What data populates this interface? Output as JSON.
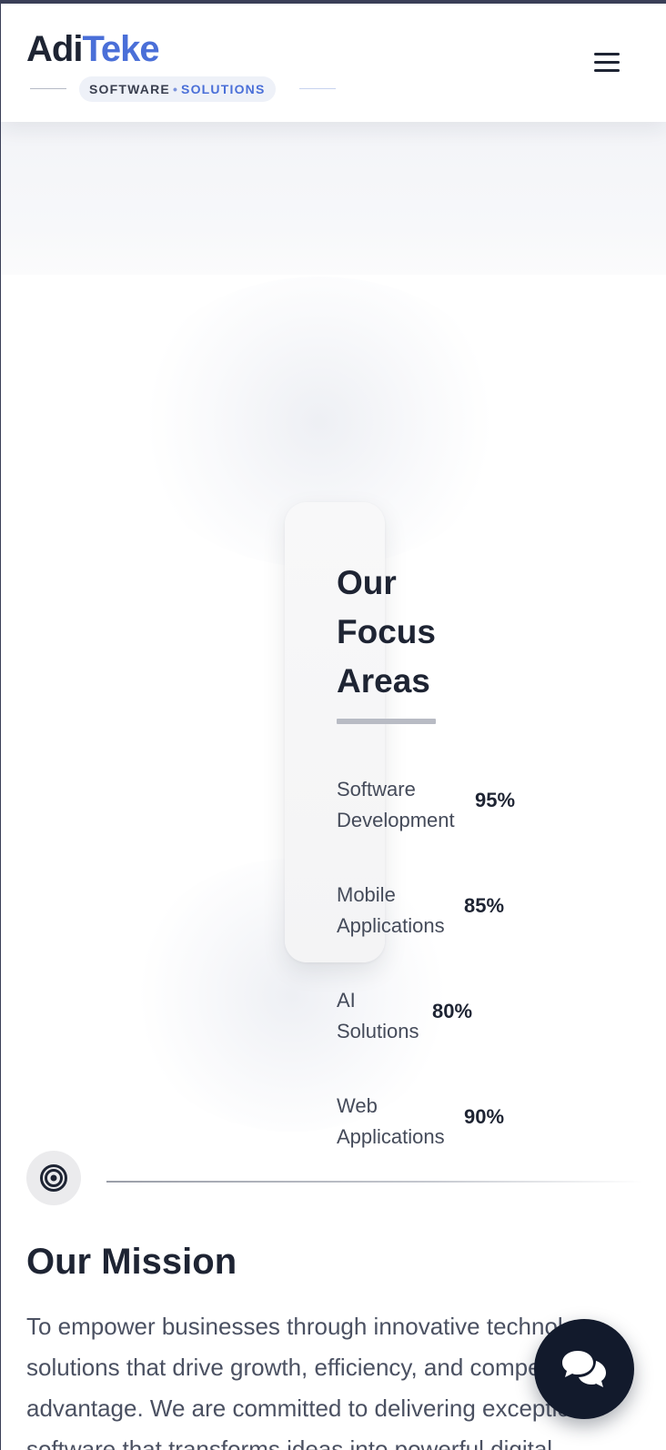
{
  "header": {
    "logo_part1": "Adi",
    "logo_part2": "Teke",
    "tagline_part1": "SOFTWARE",
    "tagline_separator": "•",
    "tagline_part2": "SOLUTIONS",
    "menu_icon": "hamburger-menu-icon"
  },
  "focus": {
    "title": "Our Focus Areas",
    "items": [
      {
        "label_line1": "Software",
        "label_line2": "Development",
        "percent": "95%"
      },
      {
        "label_line1": "Mobile",
        "label_line2": "Applications",
        "percent": "85%"
      },
      {
        "label_line1": "AI",
        "label_line2": "Solutions",
        "percent": "80%"
      },
      {
        "label_line1": "Web",
        "label_line2": "Applications",
        "percent": "90%"
      }
    ]
  },
  "mission": {
    "icon": "target-icon",
    "title": "Our Mission",
    "text": "To empower businesses through innovative technology solutions that drive growth, efficiency, and competitive advantage. We are committed to delivering exceptional software that transforms ideas into powerful digital"
  },
  "chat": {
    "icon": "chat-bubbles-icon"
  },
  "colors": {
    "brand_dark": "#1e2433",
    "brand_blue": "#4a6fd8",
    "fab_bg": "#121a2c"
  }
}
